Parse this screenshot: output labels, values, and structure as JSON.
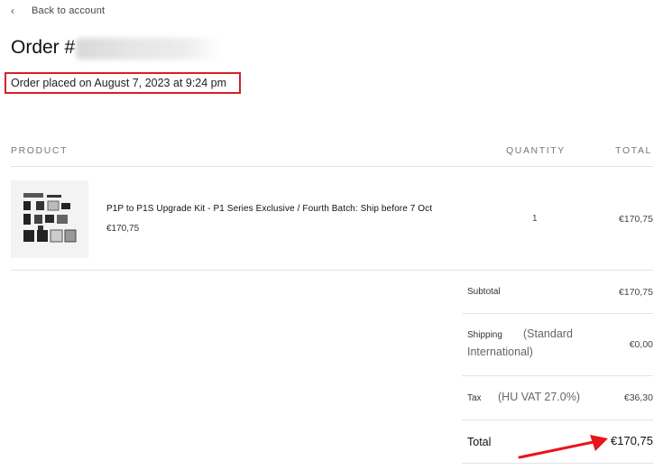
{
  "nav": {
    "back_label": "Back to account"
  },
  "order": {
    "title_prefix": "Order #",
    "placed_text": "Order placed on August 7, 2023 at 9:24 pm"
  },
  "table": {
    "headers": {
      "product": "PRODUCT",
      "quantity": "QUANTITY",
      "total": "TOTAL"
    },
    "item": {
      "name": "P1P to P1S Upgrade Kit - P1 Series Exclusive / Fourth Batch: Ship before 7 Oct",
      "price": "€170,75",
      "quantity": "1",
      "total": "€170,75"
    }
  },
  "summary": {
    "subtotal": {
      "label": "Subtotal",
      "value": "€170,75"
    },
    "shipping": {
      "label": "Shipping",
      "detail_line1": "(Standard",
      "detail_line2": "International)",
      "value": "€0,00"
    },
    "tax": {
      "label": "Tax",
      "detail": "(HU VAT 27.0%)",
      "value": "€36,30"
    },
    "total": {
      "label": "Total",
      "value": "€170,75"
    }
  },
  "colors": {
    "highlight_box": "#d61f26",
    "arrow": "#e8141c"
  }
}
